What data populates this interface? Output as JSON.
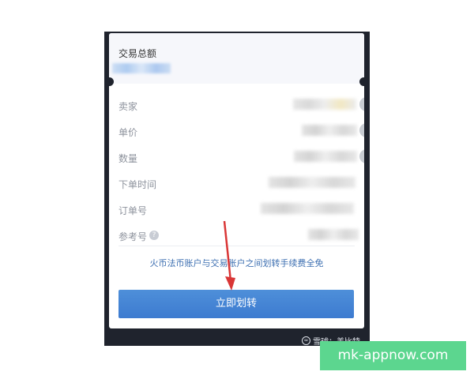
{
  "dialog": {
    "total_label": "交易总额",
    "rows": [
      {
        "label": "卖家"
      },
      {
        "label": "单价"
      },
      {
        "label": "数量"
      },
      {
        "label": "下单时间"
      },
      {
        "label": "订单号"
      },
      {
        "label": "参考号"
      }
    ],
    "promo_text": "火币法币账户与交易账户之间划转手续费全免",
    "transfer_button": "立即划转"
  },
  "watermark": {
    "xueqiu": "雪球：美比特",
    "site": "mk-appnow.com"
  },
  "colors": {
    "accent": "#3d7bd0",
    "promo_text": "#3d6fb1",
    "banner": "#5cd68f",
    "frame": "#1f232d"
  }
}
